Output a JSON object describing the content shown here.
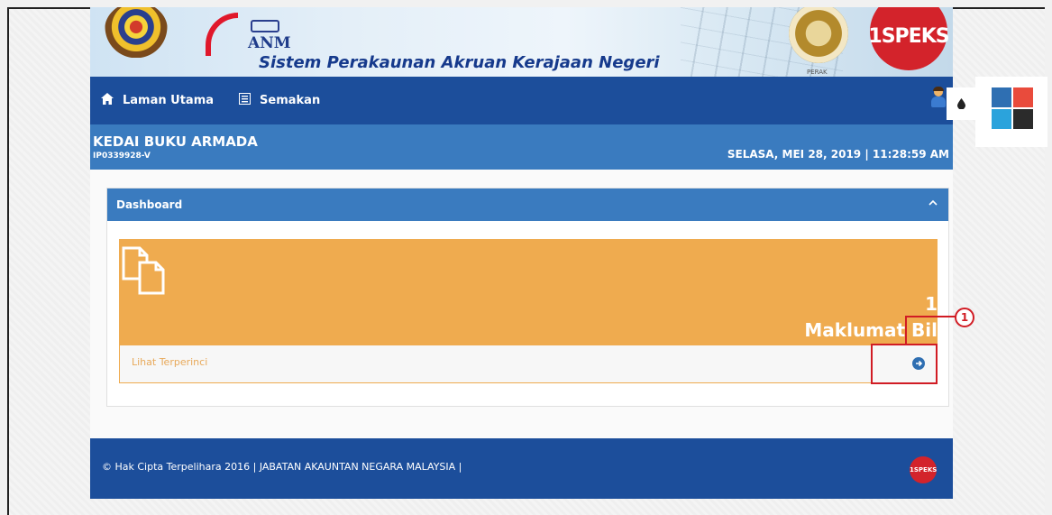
{
  "banner": {
    "logo_text": "ANM",
    "system_title": "Sistem Perakaunan Akruan Kerajaan Negeri",
    "state_label": "PERAK",
    "badge_text": "1SPEKS"
  },
  "navbar": {
    "items": [
      {
        "label": "Laman Utama",
        "icon": "home-icon"
      },
      {
        "label": "Semakan",
        "icon": "list-icon"
      }
    ],
    "user_icon": "user-icon"
  },
  "theme": {
    "toggle_icon": "droplet-icon",
    "swatches": [
      "#2f6fb2",
      "#e94b3c",
      "#2ba3dc",
      "#2b2b2b"
    ]
  },
  "company": {
    "name": "KEDAI BUKU ARMADA",
    "id": "IP0339928-V",
    "datetime": "SELASA, MEI 28, 2019 | 11:28:59 AM"
  },
  "dashboard": {
    "title": "Dashboard",
    "stat": {
      "value": "1",
      "label": "Maklumat Bil",
      "icon": "documents-icon",
      "link_text": "Lihat Terperinci"
    }
  },
  "annotation": {
    "marker": "1"
  },
  "footer": {
    "copyright": "© Hak Cipta Terpelihara 2016 | JABATAN AKAUNTAN NEGARA MALAYSIA |",
    "logo_text": "1SPEKS"
  }
}
